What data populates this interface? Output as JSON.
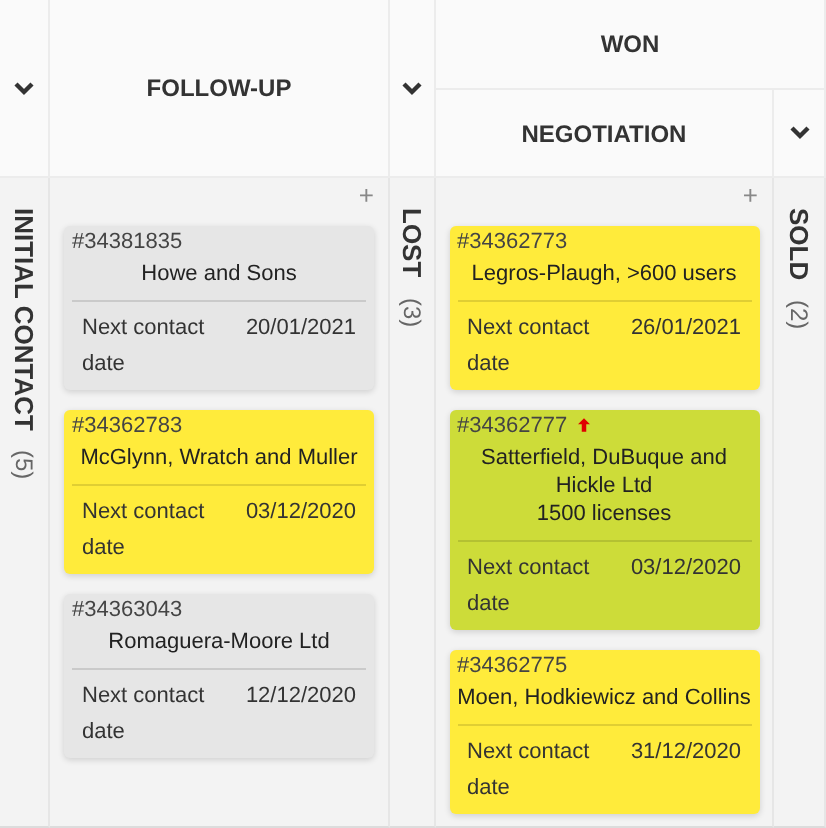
{
  "group_header": {
    "label": "WON"
  },
  "columns": [
    {
      "kind": "collapsed",
      "title": "INITIAL CONTACT",
      "count": "(5)"
    },
    {
      "kind": "open",
      "title": "FOLLOW-UP",
      "add": "+",
      "cards": [
        {
          "id": "#34381835",
          "title": "Howe and Sons",
          "label": "Next contact date",
          "date": "20/01/2021",
          "color": "#e6e6e6",
          "urgent": false
        },
        {
          "id": "#34362783",
          "title": "McGlynn, Wratch and Muller",
          "label": "Next contact date",
          "date": "03/12/2020",
          "color": "#ffeb3b",
          "urgent": false
        },
        {
          "id": "#34363043",
          "title": "Romaguera-Moore Ltd",
          "label": "Next contact date",
          "date": "12/12/2020",
          "color": "#e6e6e6",
          "urgent": false
        }
      ]
    },
    {
      "kind": "collapsed",
      "title": "LOST",
      "count": "(3)"
    },
    {
      "kind": "open",
      "title": "NEGOTIATION",
      "add": "+",
      "cards": [
        {
          "id": "#34362773",
          "title": "Legros-Plaugh, >600 users",
          "label": "Next contact date",
          "date": "26/01/2021",
          "color": "#ffeb3b",
          "urgent": false
        },
        {
          "id": "#34362777",
          "title": "Satterfield, DuBuque and Hickle Ltd\n1500 licenses",
          "label": "Next contact date",
          "date": "03/12/2020",
          "color": "#cddc39",
          "urgent": true
        },
        {
          "id": "#34362775",
          "title": "Moen, Hodkiewicz and Collins",
          "label": "Next contact date",
          "date": "31/12/2020",
          "color": "#ffeb3b",
          "urgent": false
        }
      ]
    },
    {
      "kind": "collapsed",
      "title": "SOLD",
      "count": "(2)"
    }
  ]
}
